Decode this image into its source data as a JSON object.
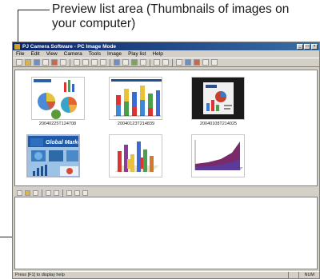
{
  "callout": {
    "text": "Preview list area (Thumbnails of images on your computer)"
  },
  "window": {
    "title": "PJ Camera Software - PC Image Mode",
    "menu": [
      "File",
      "Edit",
      "View",
      "Camera",
      "Tools",
      "Image",
      "Play list",
      "Help"
    ]
  },
  "thumbnails": [
    {
      "caption": "20040225T124708",
      "kind": "pie-charts",
      "selected": false
    },
    {
      "caption": "20040123T214839",
      "kind": "bar-chart",
      "selected": false
    },
    {
      "caption": "20040108T214025",
      "kind": "dark-slide",
      "selected": false
    },
    {
      "caption": "",
      "kind": "global-market",
      "selected": true
    },
    {
      "caption": "",
      "kind": "3d-bar-chart",
      "selected": false
    },
    {
      "caption": "",
      "kind": "area-chart",
      "selected": false
    }
  ],
  "statusbar": {
    "message": "Press [F1] to display help",
    "mode": "NUM"
  }
}
